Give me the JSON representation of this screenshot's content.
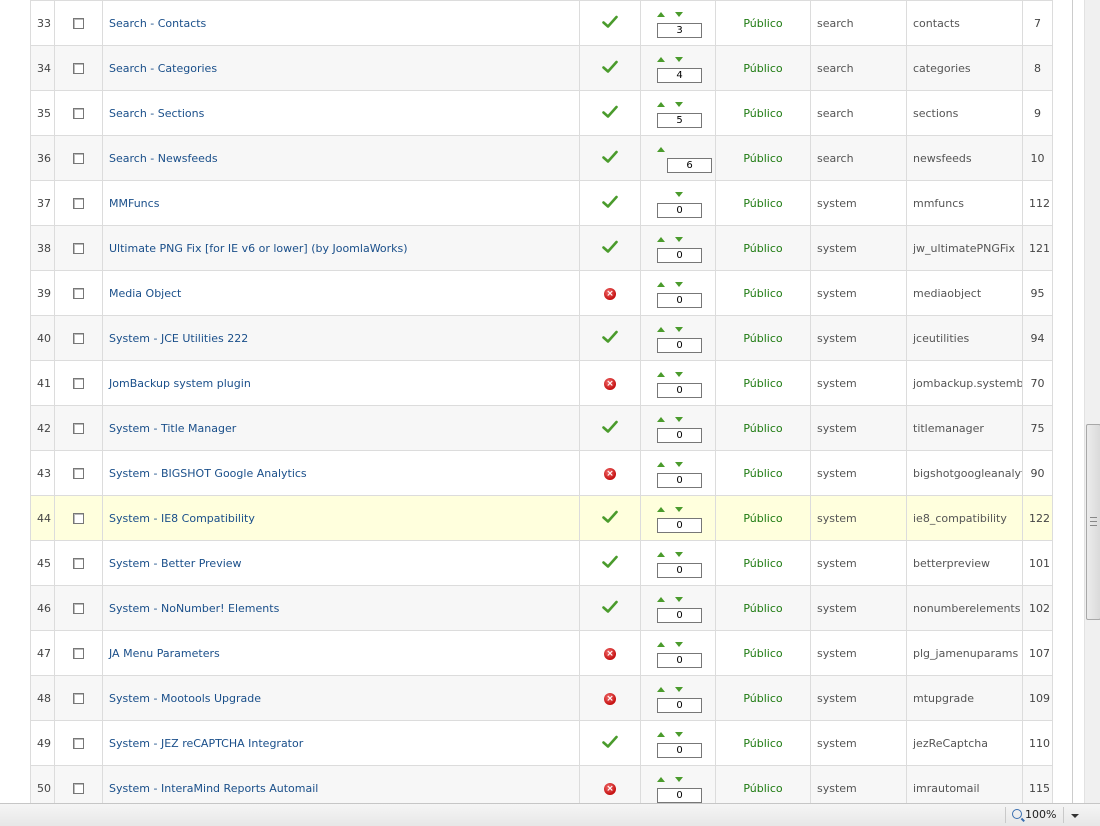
{
  "rows": [
    {
      "num": "33",
      "name": "Search - Contacts",
      "enabled": true,
      "up": true,
      "down": true,
      "order": "3",
      "access": "Público",
      "type": "search",
      "element": "contacts",
      "id": "7"
    },
    {
      "num": "34",
      "name": "Search - Categories",
      "enabled": true,
      "up": true,
      "down": true,
      "order": "4",
      "access": "Público",
      "type": "search",
      "element": "categories",
      "id": "8"
    },
    {
      "num": "35",
      "name": "Search - Sections",
      "enabled": true,
      "up": true,
      "down": true,
      "order": "5",
      "access": "Público",
      "type": "search",
      "element": "sections",
      "id": "9"
    },
    {
      "num": "36",
      "name": "Search - Newsfeeds",
      "enabled": true,
      "up": true,
      "down": false,
      "order": "6",
      "access": "Público",
      "type": "search",
      "element": "newsfeeds",
      "id": "10"
    },
    {
      "num": "37",
      "name": "MMFuncs",
      "enabled": true,
      "up": false,
      "down": true,
      "order": "0",
      "access": "Público",
      "type": "system",
      "element": "mmfuncs",
      "id": "112"
    },
    {
      "num": "38",
      "name": "Ultimate PNG Fix [for IE v6 or lower] (by JoomlaWorks)",
      "enabled": true,
      "up": true,
      "down": true,
      "order": "0",
      "access": "Público",
      "type": "system",
      "element": "jw_ultimatePNGFix",
      "id": "121"
    },
    {
      "num": "39",
      "name": "Media Object",
      "enabled": false,
      "up": true,
      "down": true,
      "order": "0",
      "access": "Público",
      "type": "system",
      "element": "mediaobject",
      "id": "95"
    },
    {
      "num": "40",
      "name": "System - JCE Utilities 222",
      "enabled": true,
      "up": true,
      "down": true,
      "order": "0",
      "access": "Público",
      "type": "system",
      "element": "jceutilities",
      "id": "94"
    },
    {
      "num": "41",
      "name": "JomBackup system plugin",
      "enabled": false,
      "up": true,
      "down": true,
      "order": "0",
      "access": "Público",
      "type": "system",
      "element": "jombackup.systembot",
      "id": "70"
    },
    {
      "num": "42",
      "name": "System - Title Manager",
      "enabled": true,
      "up": true,
      "down": true,
      "order": "0",
      "access": "Público",
      "type": "system",
      "element": "titlemanager",
      "id": "75"
    },
    {
      "num": "43",
      "name": "System - BIGSHOT Google Analytics",
      "enabled": false,
      "up": true,
      "down": true,
      "order": "0",
      "access": "Público",
      "type": "system",
      "element": "bigshotgoogleanalytics",
      "id": "90"
    },
    {
      "num": "44",
      "name": "System - IE8 Compatibility",
      "enabled": true,
      "up": true,
      "down": true,
      "order": "0",
      "access": "Público",
      "type": "system",
      "element": "ie8_compatibility",
      "id": "122",
      "highlight": true
    },
    {
      "num": "45",
      "name": "System - Better Preview",
      "enabled": true,
      "up": true,
      "down": true,
      "order": "0",
      "access": "Público",
      "type": "system",
      "element": "betterpreview",
      "id": "101"
    },
    {
      "num": "46",
      "name": "System - NoNumber! Elements",
      "enabled": true,
      "up": true,
      "down": true,
      "order": "0",
      "access": "Público",
      "type": "system",
      "element": "nonumberelements",
      "id": "102"
    },
    {
      "num": "47",
      "name": "JA Menu Parameters",
      "enabled": false,
      "up": true,
      "down": true,
      "order": "0",
      "access": "Público",
      "type": "system",
      "element": "plg_jamenuparams",
      "id": "107"
    },
    {
      "num": "48",
      "name": "System - Mootools Upgrade",
      "enabled": false,
      "up": true,
      "down": true,
      "order": "0",
      "access": "Público",
      "type": "system",
      "element": "mtupgrade",
      "id": "109"
    },
    {
      "num": "49",
      "name": "System - JEZ reCAPTCHA Integrator",
      "enabled": true,
      "up": true,
      "down": true,
      "order": "0",
      "access": "Público",
      "type": "system",
      "element": "jezReCaptcha",
      "id": "110"
    },
    {
      "num": "50",
      "name": "System - InteraMind Reports Automail",
      "enabled": false,
      "up": true,
      "down": true,
      "order": "0",
      "access": "Público",
      "type": "system",
      "element": "imrautomail",
      "id": "115"
    }
  ],
  "icons": {
    "enabled": "checkmark-icon",
    "disabled": "cross-icon",
    "order_up": "arrow-up-icon",
    "order_down": "arrow-down-icon",
    "zoom": "magnifier-icon"
  },
  "colors": {
    "link": "#1a4f8a",
    "access": "#1d7a10",
    "check_green": "#4a9b2c",
    "disabled_red": "#c40f0f",
    "highlight_row": "#ffffdd"
  },
  "statusbar": {
    "zoom_label": "100%"
  }
}
